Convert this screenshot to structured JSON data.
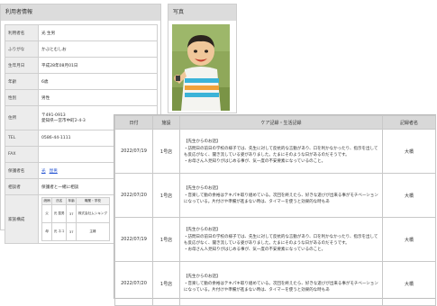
{
  "info": {
    "title": "利用者情報",
    "rows": [
      {
        "label": "利用者名",
        "value": "光 生男"
      },
      {
        "label": "ふりがな",
        "value": "かぶとむしお"
      },
      {
        "label": "生年月日",
        "value": "平成28年08月01日"
      },
      {
        "label": "年齢",
        "value": "6歳"
      },
      {
        "label": "性別",
        "value": "男性"
      },
      {
        "label": "住所",
        "value": "〒491-0913",
        "value2": "愛知県一宮市中町2-4-3"
      },
      {
        "label": "TEL",
        "value": "0586-44-1111"
      },
      {
        "label": "FAX",
        "value": ""
      },
      {
        "label": "保護者名",
        "value": "光",
        "value2": "昆男"
      },
      {
        "label": "相談者",
        "value": "保護者と一緒に相談"
      },
      {
        "label": "家族構成",
        "value": ""
      }
    ],
    "family": {
      "headers": [
        "続柄",
        "氏名",
        "年齢",
        "職業・学校"
      ],
      "rows": [
        [
          "父",
          "光 昆男",
          "37",
          "株式会社ムシキング"
        ],
        [
          "母",
          "光 ネコ",
          "37",
          "主婦"
        ]
      ]
    }
  },
  "photo": {
    "title": "写真"
  },
  "care": {
    "headers": [
      "日付",
      "施設",
      "ケア記録・生活記録",
      "記録者名"
    ],
    "rows": [
      {
        "date": "2022/07/19",
        "facility": "1号店",
        "heading": "【先生からのお話】",
        "lines": [
          "・訪問日の前日の学校の様子では、先生に対して反抗的な言動があり、口を利かなかったり、指示を出しても反応がなく、聞き流している姿がありました。たまにそのような日があるのだそうです。",
          "・お母さん人見知りがはじめる事が、気一度の不安要素になっているのこと。"
        ],
        "recorder": "大橋"
      },
      {
        "date": "2022/07/20",
        "facility": "1号店",
        "heading": "【先生からのお話】",
        "lines": [
          "・音楽して動の余裕はテキパキ取り組めている。次回を終えたら、好きな遊びが出来る事がモチベーションになっている。片付けや準備が進まない時は、タイマーを使うと効果的な時もあ"
        ],
        "recorder": "大橋"
      },
      {
        "date": "2022/07/19",
        "facility": "1号店",
        "heading": "【先生からのお話】",
        "lines": [
          "・訪問日の前日の学校の様子では、先生に対して反抗的な言動があり、口を利かなかったり、指示を出しても反応がなく、聞き流している姿がありました。たまにそのような日があるのだそうです。",
          "・お母さん人見知りがはじめる事が、気一度の不安要素になっているのこと。"
        ],
        "recorder": "大橋"
      },
      {
        "date": "2022/07/20",
        "facility": "1号店",
        "heading": "【先生からのお話】",
        "lines": [
          "・音楽して動の余裕はテキパキ取り組めている。次回を終えたら、好きな遊びが出来る事がモチベーションになっている。片付けや準備が進まない時は、タイマーを使うと効果的な時もあ"
        ],
        "recorder": "大橋"
      }
    ]
  }
}
